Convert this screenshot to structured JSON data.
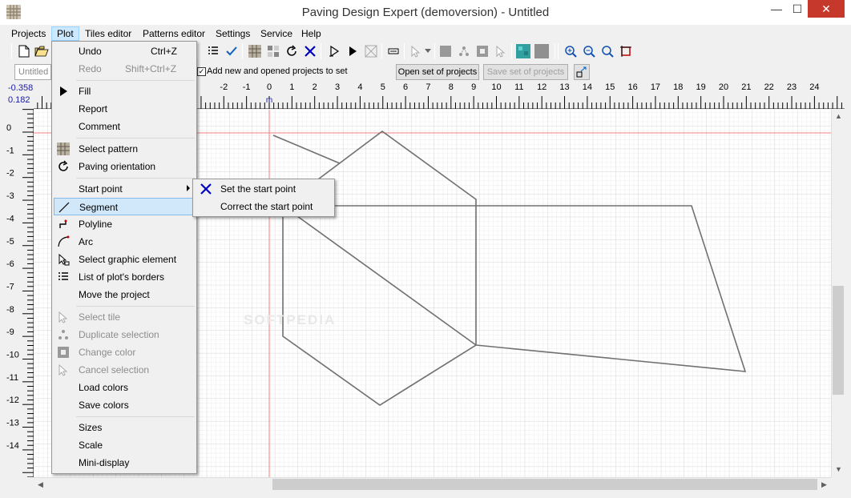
{
  "window": {
    "title": "Paving Design Expert (demoversion) - Untitled",
    "minimize": "—",
    "maximize": "☐",
    "close": "✕"
  },
  "menubar": [
    "Projects",
    "Plot",
    "Tiles editor",
    "Patterns editor",
    "Settings",
    "Service",
    "Help"
  ],
  "menubar_active": "Plot",
  "projects_bar": {
    "tab_label": "Untitled",
    "add_checkbox_label": "Add new and opened projects to set",
    "add_checked": true,
    "open_set": "Open set of projects",
    "save_set": "Save set of projects"
  },
  "coords": {
    "x": "-0.358",
    "y": "0.182"
  },
  "ruler": {
    "h_labels": [
      "-2",
      "-1",
      "0",
      "1",
      "2",
      "3",
      "4",
      "5",
      "6",
      "7",
      "8",
      "9",
      "10",
      "11",
      "12",
      "13",
      "14",
      "15",
      "16",
      "17",
      "18",
      "19",
      "20",
      "21",
      "22",
      "23",
      "24"
    ],
    "unit": "m",
    "v_labels": [
      "0",
      "-1",
      "-2",
      "-3",
      "-4",
      "-5",
      "-6",
      "-7",
      "-8",
      "-9",
      "-10",
      "-11",
      "-12",
      "-13",
      "-14"
    ]
  },
  "plot_menu": {
    "undo": "Undo",
    "undo_shortcut": "Ctrl+Z",
    "redo": "Redo",
    "redo_shortcut": "Shift+Ctrl+Z",
    "fill": "Fill",
    "report": "Report",
    "comment": "Comment",
    "select_pattern": "Select pattern",
    "paving_orientation": "Paving orientation",
    "start_point": "Start point",
    "segment": "Segment",
    "polyline": "Polyline",
    "arc": "Arc",
    "select_graphic": "Select graphic element",
    "list_borders": "List of plot's borders",
    "move_project": "Move the project",
    "select_tile": "Select tile",
    "duplicate_selection": "Duplicate selection",
    "change_color": "Change color",
    "cancel_selection": "Cancel selection",
    "load_colors": "Load colors",
    "save_colors": "Save colors",
    "sizes": "Sizes",
    "scale": "Scale",
    "mini_display": "Mini-display"
  },
  "start_point_submenu": {
    "set": "Set the start point",
    "correct": "Correct the start point"
  },
  "watermark": "SOFTPEDIA"
}
